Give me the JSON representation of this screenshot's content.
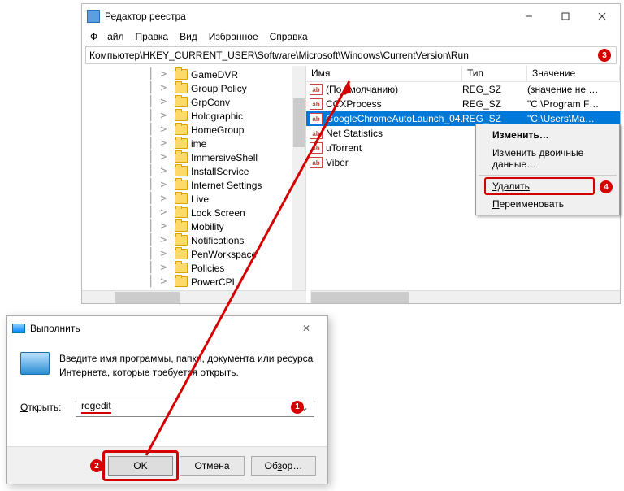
{
  "regedit": {
    "title": "Редактор реестра",
    "menu": {
      "file": "Файл",
      "edit": "Правка",
      "view": "Вид",
      "fav": "Избранное",
      "help": "Справка"
    },
    "address": "Компьютер\\HKEY_CURRENT_USER\\Software\\Microsoft\\Windows\\CurrentVersion\\Run",
    "tree": [
      "GameDVR",
      "Group Policy",
      "GrpConv",
      "Holographic",
      "HomeGroup",
      "ime",
      "ImmersiveShell",
      "InstallService",
      "Internet Settings",
      "Live",
      "Lock Screen",
      "Mobility",
      "Notifications",
      "PenWorkspace",
      "Policies",
      "PowerCPL"
    ],
    "cols": {
      "name": "Имя",
      "type": "Тип",
      "value": "Значение"
    },
    "rows": [
      {
        "name": "(По умолчанию)",
        "type": "REG_SZ",
        "value": "(значение не …"
      },
      {
        "name": "CCXProcess",
        "type": "REG_SZ",
        "value": "\"C:\\Program F…"
      },
      {
        "name": "GoogleChromeAutoLaunch_04…",
        "type": "REG_SZ",
        "value": "\"C:\\Users\\Ma…",
        "sel": true
      },
      {
        "name": "Net Statistics",
        "type": "",
        "value": ""
      },
      {
        "name": "uTorrent",
        "type": "",
        "value": ""
      },
      {
        "name": "Viber",
        "type": "",
        "value": ""
      }
    ],
    "ctx": {
      "modify": "Изменить…",
      "modify_bin": "Изменить двоичные данные…",
      "delete": "Удалить",
      "rename": "Переименовать"
    }
  },
  "run": {
    "title": "Выполнить",
    "prompt": "Введите имя программы, папки, документа или ресурса Интернета, которые требуется открыть.",
    "open_label": "Открыть:",
    "value": "regedit",
    "ok": "OK",
    "cancel": "Отмена",
    "browse": "Обзор…"
  },
  "badges": {
    "b1": "1",
    "b2": "2",
    "b3": "3",
    "b4": "4"
  }
}
